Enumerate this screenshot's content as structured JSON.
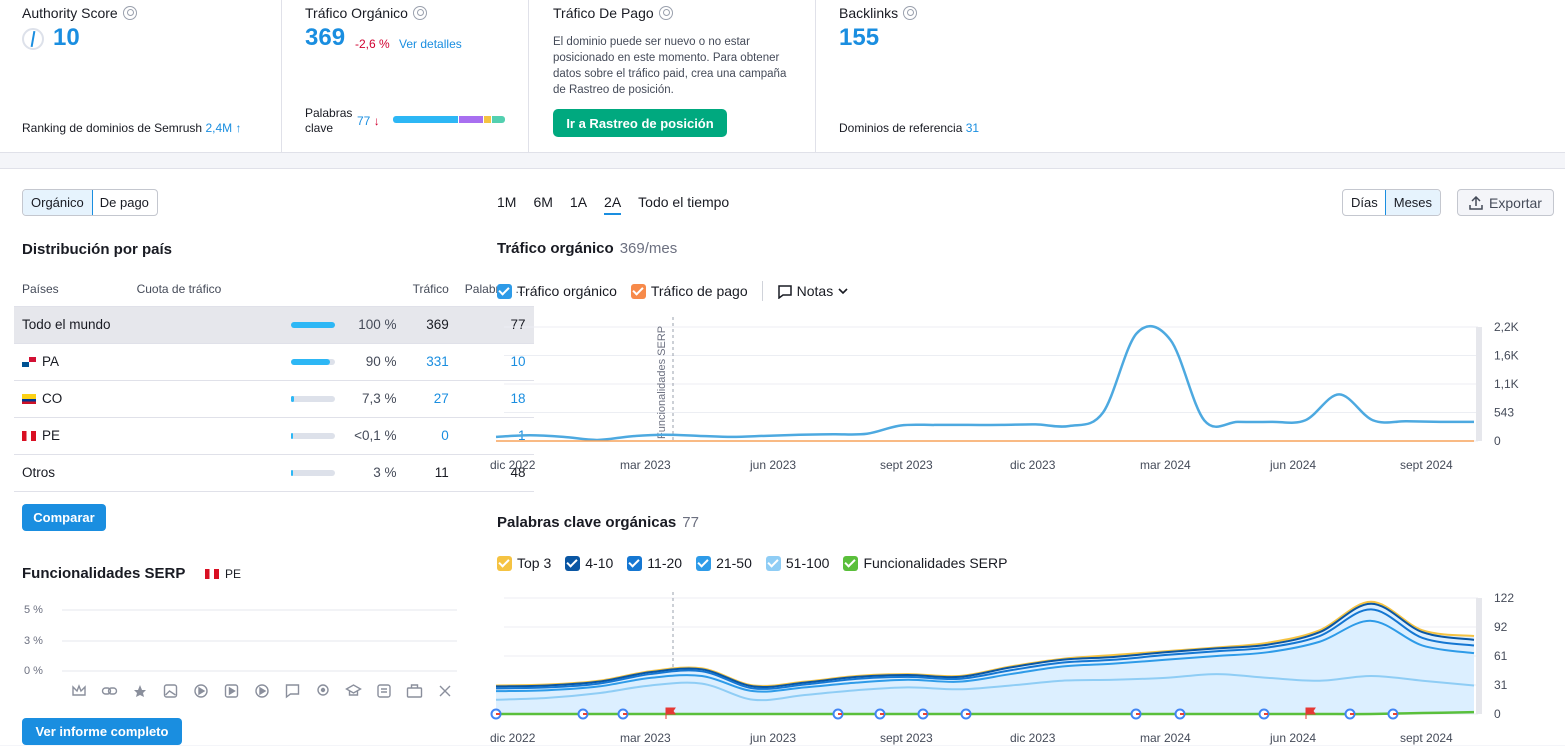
{
  "metrics": {
    "authority": {
      "title": "Authority Score",
      "value": "10",
      "ranking_label": "Ranking de dominios de Semrush",
      "ranking_value": "2,4M"
    },
    "organic": {
      "title": "Tráfico Orgánico",
      "value": "369",
      "change": "-2,6 %",
      "details_link": "Ver detalles",
      "keywords_label_1": "Palabras",
      "keywords_label_2": "clave",
      "keywords_value": "77"
    },
    "paid": {
      "title": "Tráfico De Pago",
      "description": "El dominio puede ser nuevo o no estar posicionado en este momento. Para obtener datos sobre el tráfico paid, crea una campaña de Rastreo de posición.",
      "button": "Ir a Rastreo de posición"
    },
    "backlinks": {
      "title": "Backlinks",
      "value": "155",
      "ref_label": "Dominios de referencia",
      "ref_value": "31"
    }
  },
  "toggle": {
    "organic": "Orgánico",
    "paid": "De pago"
  },
  "country": {
    "title": "Distribución por país",
    "headers": [
      "Países",
      "Cuota de tráfico",
      "Tráfico",
      "Palabras ..."
    ],
    "rows": [
      {
        "name": "Todo el mundo",
        "share": "100 %",
        "share_frac": 1.0,
        "traffic": "369",
        "keywords": "77"
      },
      {
        "name": "PA",
        "share": "90 %",
        "share_frac": 0.9,
        "traffic": "331",
        "keywords": "10"
      },
      {
        "name": "CO",
        "share": "7,3 %",
        "share_frac": 0.07,
        "traffic": "27",
        "keywords": "18"
      },
      {
        "name": "PE",
        "share": "<0,1 %",
        "share_frac": 0.0,
        "traffic": "0",
        "keywords": "1"
      },
      {
        "name": "Otros",
        "share": "3 %",
        "share_frac": 0.03,
        "traffic": "11",
        "keywords": "48"
      }
    ],
    "compare_button": "Comparar"
  },
  "serp": {
    "title": "Funcionalidades SERP",
    "country": "PE",
    "y_ticks": [
      "5 %",
      "3 %",
      "0 %"
    ],
    "full_report_button": "Ver informe completo"
  },
  "periods": [
    "1M",
    "6M",
    "1A",
    "2A",
    "Todo el tiempo"
  ],
  "active_period": "2A",
  "granularity": {
    "days": "Días",
    "months": "Meses"
  },
  "export_label": "Exportar",
  "traffic_chart": {
    "title": "Tráfico orgánico",
    "subtitle": "369/mes",
    "legend": {
      "organic": "Tráfico orgánico",
      "paid": "Tráfico de pago",
      "notes": "Notas"
    },
    "annotation": "Funcionalidades SERP",
    "colors": {
      "organic": "#4da9e0",
      "paid": "#f7a35c"
    }
  },
  "keywords_chart": {
    "title": "Palabras clave orgánicas",
    "subtitle": "77",
    "legend": [
      "Top 3",
      "4-10",
      "11-20",
      "21-50",
      "51-100",
      "Funcionalidades SERP"
    ],
    "legend_colors": [
      "#f5c342",
      "#0a56a3",
      "#1577d2",
      "#2e9be8",
      "#8fcdf5",
      "#5abf3b"
    ]
  },
  "chart_data": [
    {
      "type": "line",
      "title": "Tráfico orgánico",
      "x": [
        "dic 2022",
        "mar 2023",
        "jun 2023",
        "sept 2023",
        "dic 2023",
        "mar 2024",
        "jun 2024",
        "sept 2024"
      ],
      "y_ticks": [
        "2,2K",
        "1,6K",
        "1,1K",
        "543",
        "0"
      ],
      "ylim": [
        0,
        2200
      ],
      "series": [
        {
          "name": "Tráfico orgánico",
          "values": [
            80,
            110,
            80,
            20,
            90,
            120,
            100,
            80,
            100,
            120,
            130,
            140,
            300,
            310,
            310,
            310,
            320,
            290,
            550,
            2080,
            1950,
            400,
            370,
            370,
            400,
            900,
            400,
            380,
            370,
            369
          ]
        },
        {
          "name": "Tráfico de pago",
          "values": [
            0,
            0,
            0,
            0,
            0,
            0,
            0,
            0,
            0,
            0,
            0,
            0,
            0,
            0,
            0,
            0,
            0,
            0,
            0,
            0,
            0,
            0,
            0,
            0,
            0,
            0,
            0,
            0,
            0,
            0
          ]
        }
      ]
    },
    {
      "type": "area",
      "title": "Palabras clave orgánicas",
      "x": [
        "dic 2022",
        "mar 2023",
        "jun 2023",
        "sept 2023",
        "dic 2023",
        "mar 2024",
        "jun 2024",
        "sept 2024"
      ],
      "y_ticks": [
        "122",
        "92",
        "61",
        "31",
        "0"
      ],
      "ylim": [
        0,
        122
      ],
      "series": [
        {
          "name": "Top 3",
          "values": [
            30,
            31,
            35,
            45,
            48,
            30,
            34,
            40,
            42,
            40,
            50,
            58,
            62,
            66,
            70,
            75,
            88,
            118,
            88,
            82
          ]
        },
        {
          "name": "4-10",
          "values": [
            29,
            30,
            34,
            44,
            47,
            29,
            33,
            39,
            41,
            39,
            49,
            57,
            60,
            65,
            69,
            73,
            86,
            116,
            86,
            78
          ]
        },
        {
          "name": "11-20",
          "values": [
            27,
            28,
            32,
            42,
            45,
            27,
            31,
            37,
            39,
            37,
            46,
            54,
            57,
            62,
            66,
            70,
            82,
            110,
            80,
            72
          ]
        },
        {
          "name": "21-50",
          "values": [
            24,
            25,
            29,
            38,
            40,
            24,
            28,
            33,
            36,
            34,
            42,
            50,
            53,
            57,
            61,
            65,
            76,
            98,
            72,
            64
          ]
        },
        {
          "name": "51-100",
          "values": [
            15,
            17,
            22,
            30,
            32,
            15,
            20,
            25,
            28,
            26,
            30,
            35,
            36,
            38,
            42,
            38,
            35,
            40,
            35,
            30
          ]
        },
        {
          "name": "Funcionalidades SERP",
          "values": [
            0,
            0,
            0,
            0,
            0,
            0,
            0,
            0,
            0,
            0,
            0,
            0,
            0,
            0,
            0,
            0,
            0,
            0,
            1,
            2
          ]
        }
      ]
    }
  ]
}
